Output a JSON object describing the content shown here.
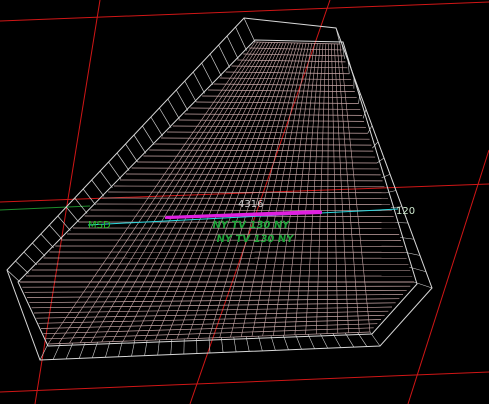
{
  "viewport": {
    "grid_label_left": "MSD",
    "grid_label_right": "120",
    "dimension_label": "4316",
    "hatch_text": "NY TV 130 NY",
    "colors": {
      "background": "#000000",
      "grid": "#d01616",
      "grid_green": "#1e8c2c",
      "wireframe_outer": "#cfcfcf",
      "wireframe_inner": "#c9a8a8",
      "axis_line": "#2fd9e0",
      "highlight": "#e020e0",
      "text_dim": "#d0d0d0",
      "text_green": "#27c027",
      "hatch": "#1fa43a"
    }
  }
}
